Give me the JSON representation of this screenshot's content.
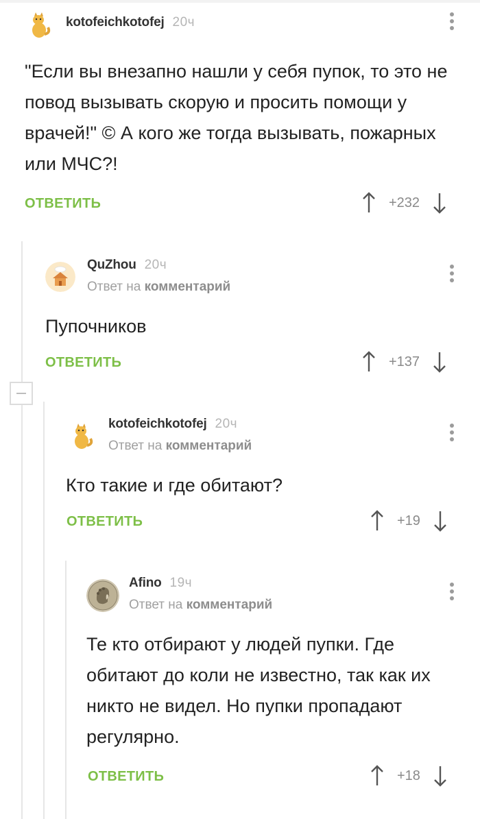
{
  "reply_label": "ОТВЕТИТЬ",
  "reply_to_prefix": "Ответ на",
  "reply_to_target": "комментарий",
  "comments": [
    {
      "author": "kotofeichkotofej",
      "time": "20ч",
      "avatar": "cat-avatar",
      "text": "\"Если вы внезапно нашли у себя пупок, то это не повод вызывать скорую и просить помощи у врачей!\" © А кого же тогда вызывать, пожарных или МЧС?!",
      "rating": "+232"
    },
    {
      "author": "QuZhou",
      "time": "20ч",
      "avatar": "house-avatar",
      "text": "Пупочников",
      "rating": "+137"
    },
    {
      "author": "kotofeichkotofej",
      "time": "20ч",
      "avatar": "cat-avatar",
      "text": "Кто такие и где обитают?",
      "rating": "+19"
    },
    {
      "author": "Afino",
      "time": "19ч",
      "avatar": "coin-portrait-avatar",
      "text": "Те кто отбирают у людей пупки. Где обитают до коли не известно, так как их никто не видел. Но пупки пропадают регулярно.",
      "rating": "+18"
    }
  ],
  "colors": {
    "reply_green": "#7dbf47",
    "thread_line": "#e6e6e6",
    "muted": "#a0a0a0"
  }
}
